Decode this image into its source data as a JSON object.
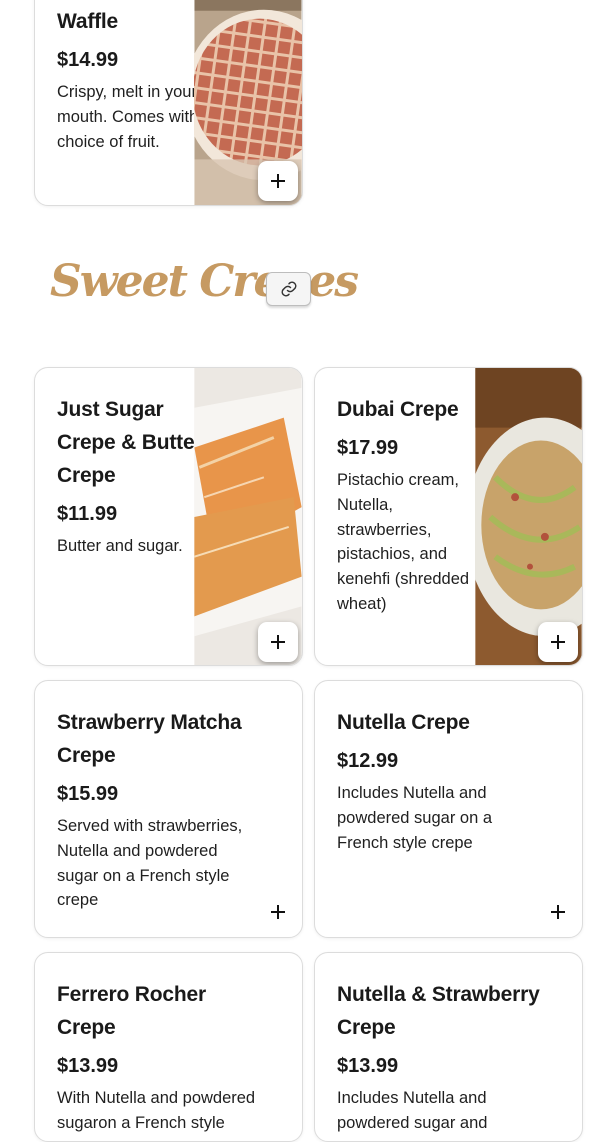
{
  "menu": {
    "waffle": {
      "title": "Waffle",
      "price": "$14.99",
      "description": "Crispy, melt in your mouth. Comes with choice of fruit."
    },
    "section": {
      "heading": "Sweet Crepes",
      "link_icon": "link-icon"
    },
    "items": [
      {
        "title": "Just Sugar Crepe & Butter Crepe",
        "price": "$11.99",
        "description": "Butter and sugar."
      },
      {
        "title": "Dubai Crepe",
        "price": "$17.99",
        "description": "Pistachio cream, Nutella, strawberries, pistachios, and kenehfi (shredded wheat)"
      },
      {
        "title": "Strawberry Matcha Crepe",
        "price": "$15.99",
        "description": "Served with strawberries, Nutella and powdered sugar on a French style crepe"
      },
      {
        "title": "Nutella Crepe",
        "price": "$12.99",
        "description": "Includes Nutella and powdered sugar on a French style crepe"
      },
      {
        "title": "Ferrero Rocher Crepe",
        "price": "$13.99",
        "description": "With Nutella and powdered sugaron a French style crepe"
      },
      {
        "title": "Nutella & Strawberry Crepe",
        "price": "$13.99",
        "description": "Includes Nutella and powdered sugar and strawberries"
      }
    ],
    "add_icon": "plus-icon"
  }
}
